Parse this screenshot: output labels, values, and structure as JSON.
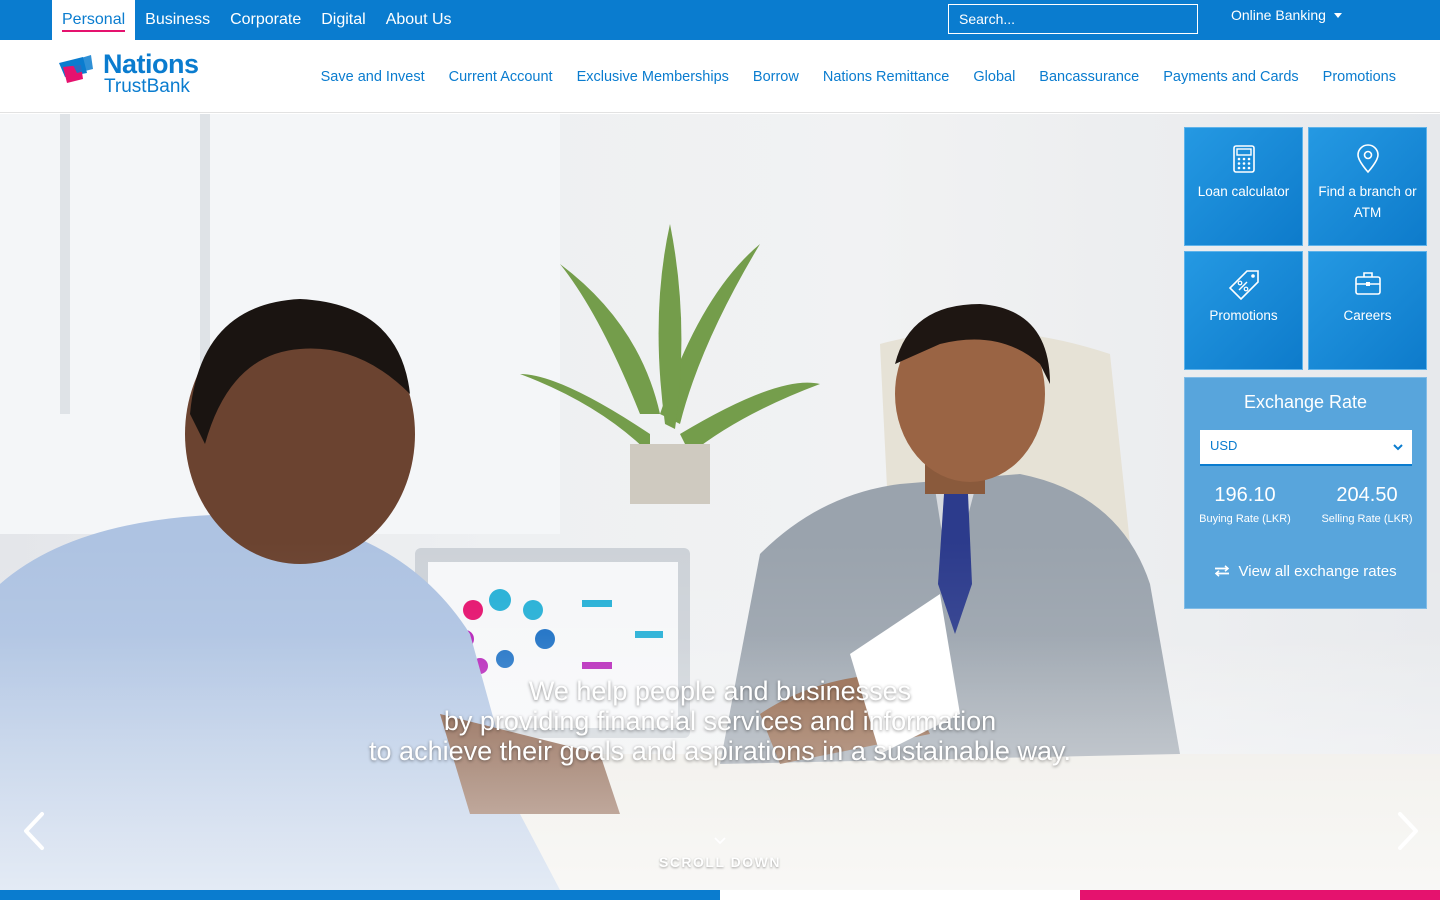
{
  "topbar": {
    "segments": [
      {
        "label": "Personal",
        "active": true
      },
      {
        "label": "Business"
      },
      {
        "label": "Corporate"
      },
      {
        "label": "Digital"
      },
      {
        "label": "About Us"
      }
    ],
    "search_placeholder": "Search...",
    "online_banking_label": "Online Banking"
  },
  "brand": {
    "name_line1": "Nations",
    "name_line2": "TrustBank"
  },
  "nav": {
    "items": [
      "Save and Invest",
      "Current Account",
      "Exclusive Memberships",
      "Borrow",
      "Nations Remittance",
      "Global",
      "Bancassurance",
      "Payments and Cards",
      "Promotions"
    ]
  },
  "hero": {
    "tagline": [
      "We help people and businesses",
      "by providing financial services and information",
      "to achieve their goals and aspirations in a sustainable way."
    ],
    "scroll_label": "SCROLL DOWN"
  },
  "tiles": [
    {
      "label": "Loan calculator",
      "icon": "calculator-icon"
    },
    {
      "label": "Find a branch or ATM",
      "icon": "map-pin-icon"
    },
    {
      "label": "Promotions",
      "icon": "price-tag-icon"
    },
    {
      "label": "Careers",
      "icon": "briefcase-icon"
    }
  ],
  "exchange": {
    "title": "Exchange Rate",
    "currency": "USD",
    "buying_rate": "196.10",
    "buying_caption": "Buying Rate (LKR)",
    "selling_rate": "204.50",
    "selling_caption": "Selling Rate (LKR)",
    "view_all_label": "View all exchange rates"
  },
  "colors": {
    "brand_blue": "#0a7ccf",
    "brand_pink": "#e5126e",
    "tile_blue": "#1290e0",
    "fx_blue": "#58a5dc"
  }
}
